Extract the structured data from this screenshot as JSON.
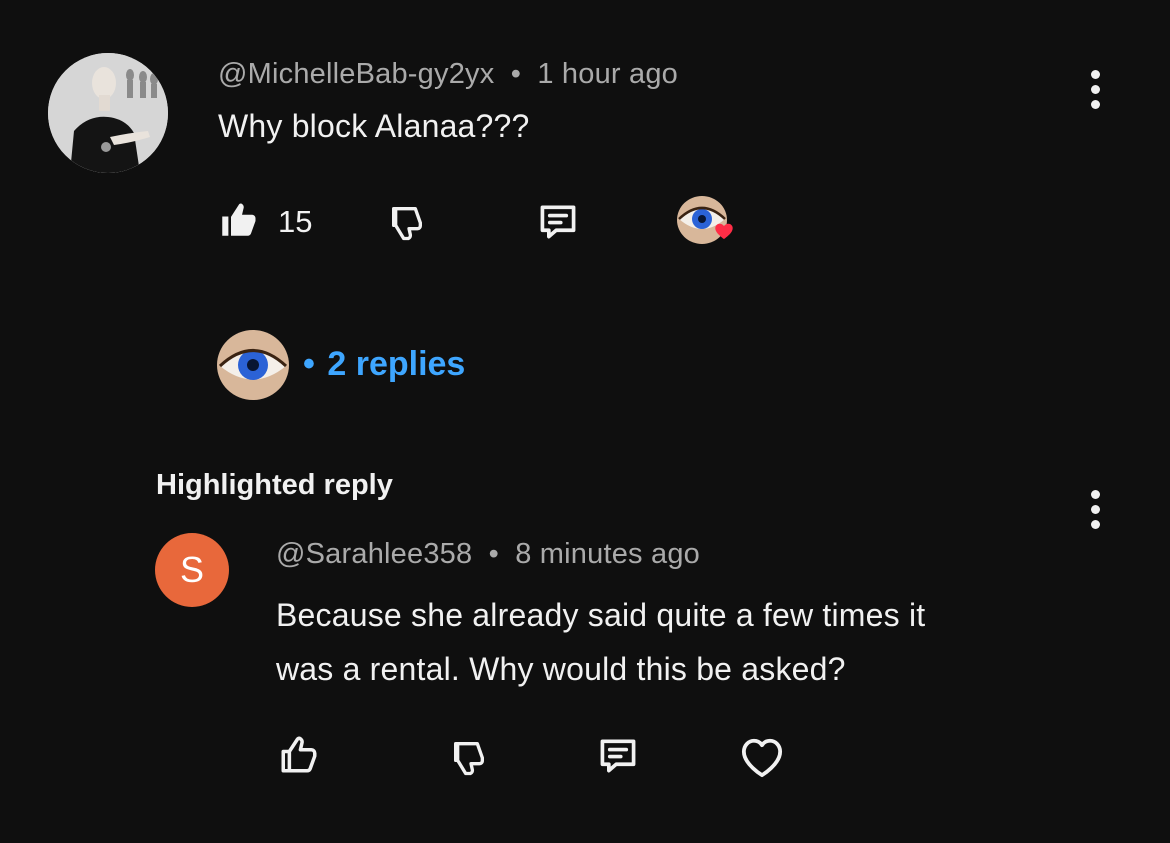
{
  "comment": {
    "author": "@MichelleBab-gy2yx",
    "separator": "•",
    "time": "1 hour ago",
    "text": "Why block Alanaa???",
    "like_count": "15",
    "replies_label": "2 replies",
    "replies_separator": "•",
    "icons": {
      "like": "thumbs-up-filled-icon",
      "dislike": "thumbs-down-icon",
      "reply": "comment-icon",
      "creator_heart": "creator-heart-badge",
      "more": "more-vert-icon"
    }
  },
  "highlighted": {
    "heading": "Highlighted reply",
    "avatar_letter": "S",
    "avatar_color": "#e8683b",
    "author": "@Sarahlee358",
    "separator": "•",
    "time": "8 minutes ago",
    "text_line1": "Because she already said quite a few times it",
    "text_line2": "was a rental. Why would this be asked?",
    "icons": {
      "like": "thumbs-up-outline-icon",
      "dislike": "thumbs-down-icon",
      "reply": "comment-icon",
      "heart": "heart-outline-icon",
      "more": "more-vert-icon"
    }
  },
  "colors": {
    "background": "#0f0f0f",
    "text": "#f1f1f1",
    "meta": "#aaaaaa",
    "link": "#3ea6ff",
    "heart": "#ff2d46"
  }
}
